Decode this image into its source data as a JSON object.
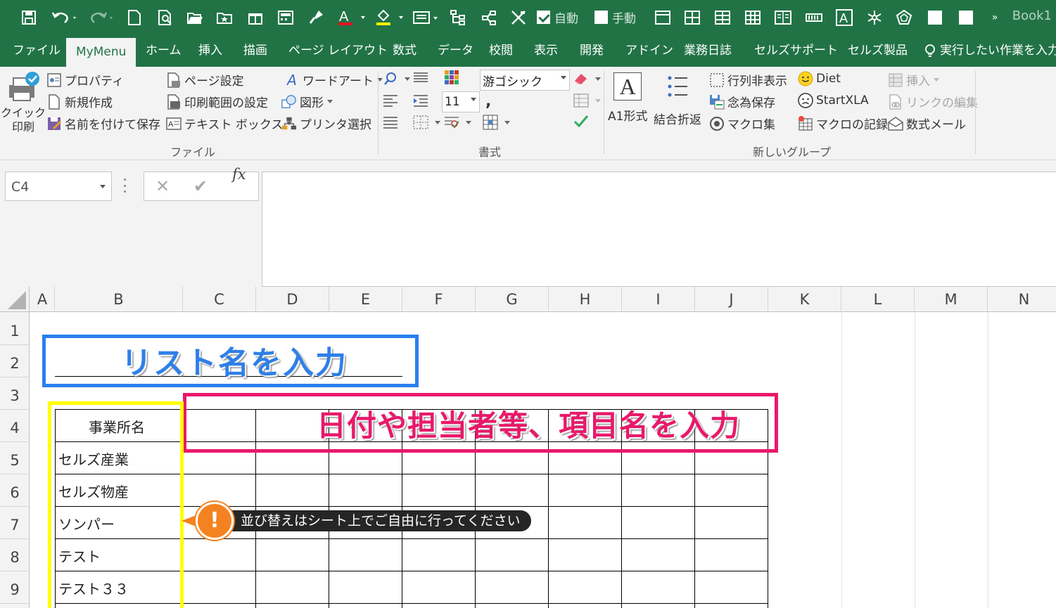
{
  "window": {
    "book_title": "Book1"
  },
  "qat": {
    "auto_label": "自動",
    "manual_label": "手動"
  },
  "tabs": [
    {
      "label": "ファイル"
    },
    {
      "label": "MyMenu"
    },
    {
      "label": "ホーム"
    },
    {
      "label": "挿入"
    },
    {
      "label": "描画"
    },
    {
      "label": "ページ レイアウト"
    },
    {
      "label": "数式"
    },
    {
      "label": "データ"
    },
    {
      "label": "校閲"
    },
    {
      "label": "表示"
    },
    {
      "label": "開発"
    },
    {
      "label": "アドイン"
    },
    {
      "label": "業務日誌"
    },
    {
      "label": "セルズサポート"
    },
    {
      "label": "セルズ製品"
    }
  ],
  "tell_me": "実行したい作業を入力",
  "ribbon": {
    "file_group": {
      "label": "ファイル",
      "quick_print": "クイック\n印刷",
      "quick_print_1": "クイック",
      "quick_print_2": "印刷",
      "properties": "プロパティ",
      "new": "新規作成",
      "save_as": "名前を付けて保存",
      "page_setup": "ページ設定",
      "print_area": "印刷範囲の設定",
      "text_box": "テキスト ボックス",
      "word_art": "ワードアート",
      "shapes": "図形",
      "printer_select": "プリンタ選択"
    },
    "format_group": {
      "label": "書式",
      "font_name": "游ゴシック",
      "font_size": "11"
    },
    "new_group": {
      "label": "新しいグループ",
      "a1_style": "A1形式",
      "merge_wrap": "結合折返",
      "toggle_rowcol": "行列非表示",
      "safety_save": "念為保存",
      "macro_collection": "マクロ集",
      "diet": "Diet",
      "start_xla": "StartXLA",
      "record_macro": "マクロの記録",
      "insert": "挿入",
      "edit_links": "リンクの編集",
      "formula_mail": "数式メール"
    }
  },
  "formula_bar": {
    "name_box": "C4",
    "fx_label": "fx",
    "formula": ""
  },
  "sheet": {
    "columns": [
      "A",
      "B",
      "C",
      "D",
      "E",
      "F",
      "G",
      "H",
      "I",
      "J",
      "K",
      "L",
      "M",
      "N"
    ],
    "rows": [
      "1",
      "2",
      "3",
      "4",
      "5",
      "6",
      "7",
      "8",
      "9"
    ],
    "header_cell": "事業所名",
    "items": [
      "セルズ産業",
      "セルズ物産",
      "ソンパー",
      "テスト",
      "テスト３３"
    ]
  },
  "annotations": {
    "list_title": "リスト名を入力",
    "header_hint": "日付や担当者等、項目名を入力",
    "tip": "並び替えはシート上でご自由に行ってください",
    "tip_icon": "!"
  },
  "colors": {
    "excel_green": "#217346",
    "blue_frame": "#2b7ff0",
    "pink_frame": "#e8196a",
    "yellow_frame": "#ffff00",
    "tip_orange": "#f58220"
  }
}
